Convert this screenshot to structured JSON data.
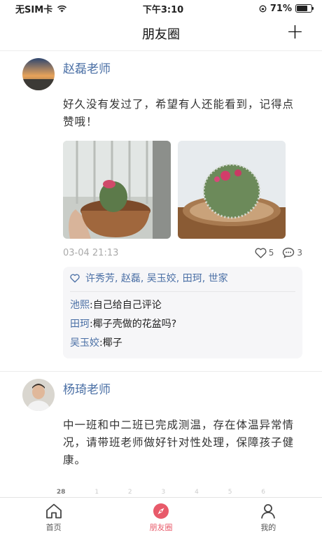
{
  "status": {
    "carrier": "无SIM卡",
    "time": "下午3:10",
    "battery": "71%"
  },
  "nav": {
    "title": "朋友圈",
    "add": "+"
  },
  "post1": {
    "author": "赵磊老师",
    "text": "好久没有发过了，希望有人还能看到，记得点赞哦！",
    "time": "03-04 21:13",
    "like_count": "5",
    "comment_count": "3",
    "likes": "许秀芳, 赵磊, 吴玉姣, 田珂, 世家",
    "comments": [
      {
        "name": "池熙",
        "text": "自己给自己评论"
      },
      {
        "name": "田珂",
        "text": "椰子壳做的花盆吗?"
      },
      {
        "name": "吴玉姣",
        "text": "椰子"
      }
    ]
  },
  "post2": {
    "author": "杨琦老师",
    "text": "中一班和中二班已完成测温，存在体温异常情况，请带班老师做好针对性处理，保障孩子健康。"
  },
  "calendar_ticks": [
    "28",
    "1",
    "2",
    "3",
    "4",
    "5",
    "6"
  ],
  "tabs": [
    {
      "label": "首页",
      "icon": "home-icon"
    },
    {
      "label": "朋友圈",
      "icon": "compass-icon"
    },
    {
      "label": "我的",
      "icon": "user-icon"
    }
  ],
  "colors": {
    "accent": "#e85a6a",
    "name": "#4a6fa5"
  }
}
